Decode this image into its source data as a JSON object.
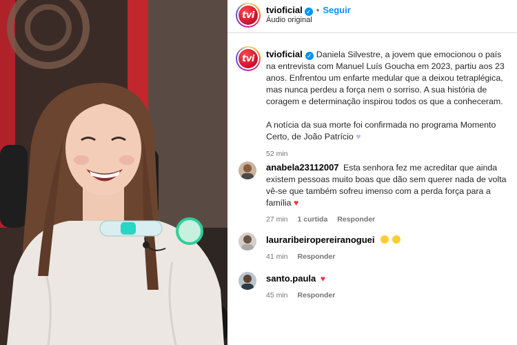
{
  "header": {
    "username": "tvioficial",
    "follow_label": "Seguir",
    "subtitle": "Áudio original",
    "avatar_text": "tvi"
  },
  "caption": {
    "username": "tvioficial",
    "paragraph1": "Daniela Silvestre, a jovem que emocionou o país na entrevista com Manuel Luís Goucha em 2023, partiu aos 23 anos. Enfrentou um enfarte medular que a deixou tetraplégica, mas nunca perdeu a força nem o sorriso. A sua história de coragem e determinação inspirou todos os que a conheceram.",
    "paragraph2": "A notícia da sua morte foi confirmada no programa Momento Certo, de João Patrício",
    "time": "52 min"
  },
  "comments": [
    {
      "username": "anabela23112007",
      "text": "Esta senhora fez me acreditar que ainda existem pessoas muito boas que dão sem querer nada de volta vê-se que também sofreu imenso com a perda força para a família",
      "time": "27 min",
      "likes": "1 curtida",
      "reply": "Responder"
    },
    {
      "username": "lauraribeiropereiranoguei",
      "text": "",
      "time": "41 min",
      "reply": "Responder"
    },
    {
      "username": "santo.paula",
      "text": "",
      "time": "45 min",
      "reply": "Responder"
    }
  ],
  "colors": {
    "accent": "#0095f6",
    "heart": "#ff3040",
    "muted": "#737373"
  }
}
